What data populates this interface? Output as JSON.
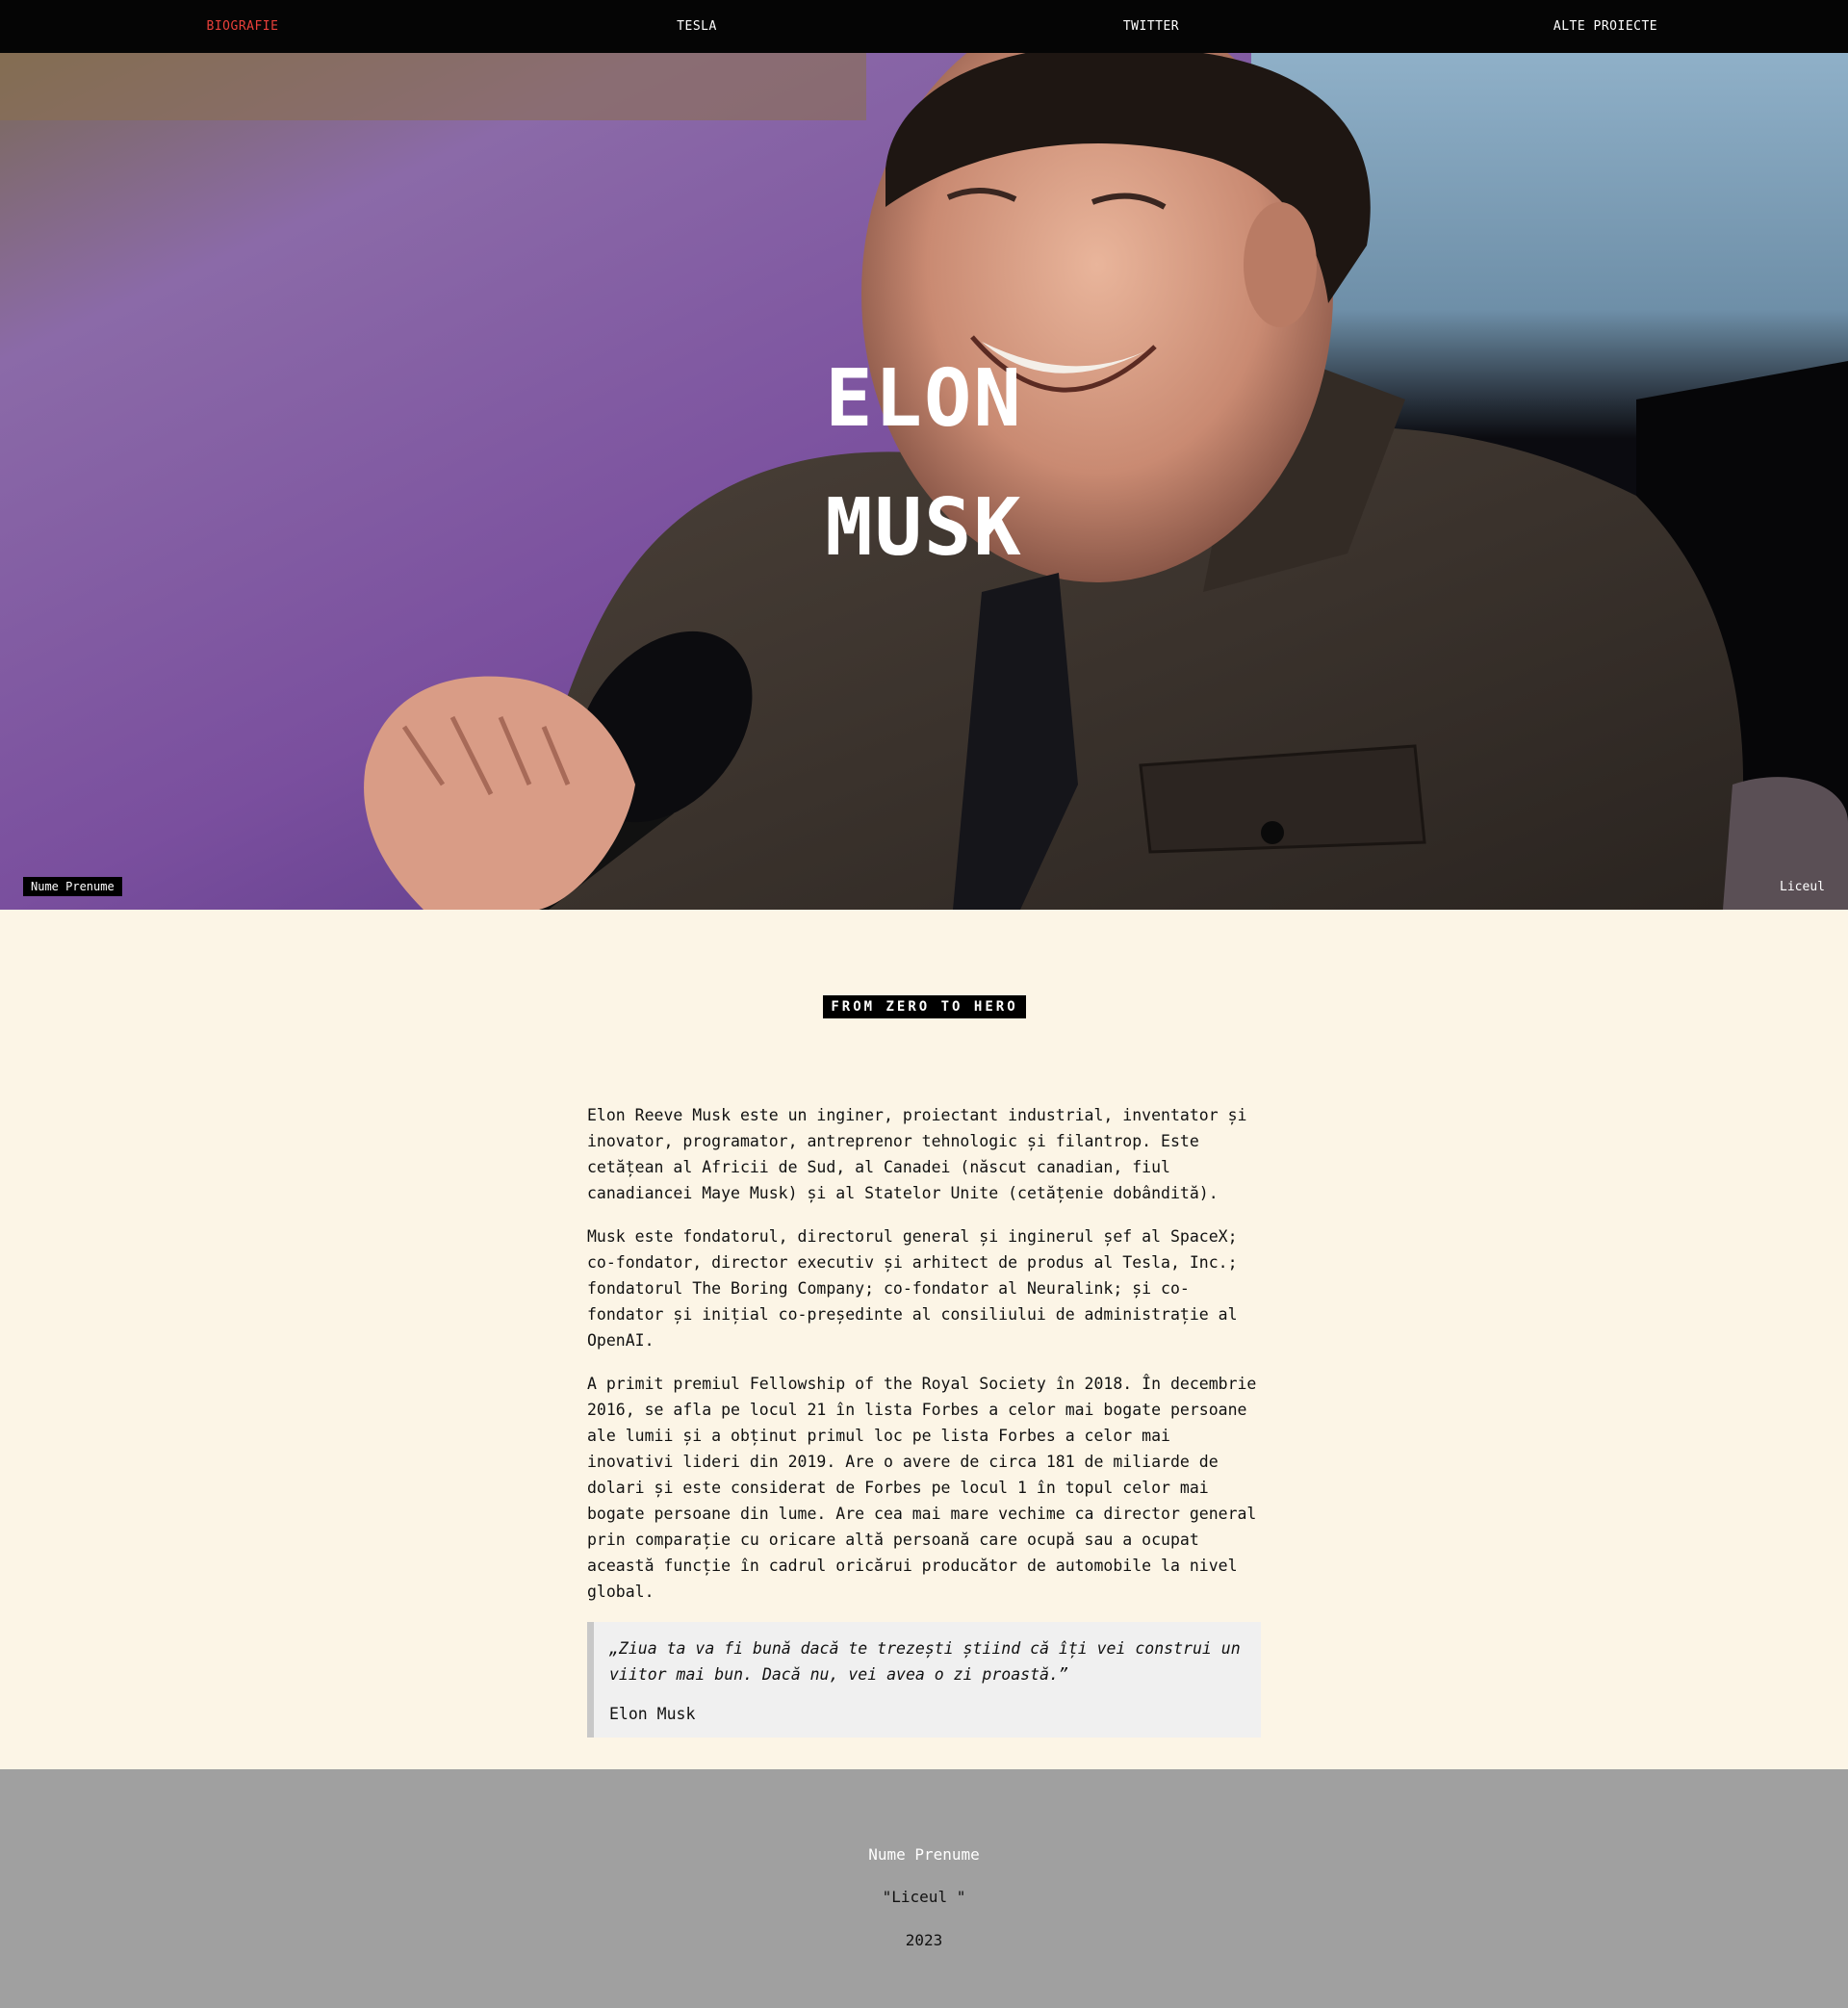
{
  "nav": {
    "items": [
      {
        "label": "BIOGRAFIE",
        "active": true
      },
      {
        "label": "TESLA",
        "active": false
      },
      {
        "label": "TWITTER",
        "active": false
      },
      {
        "label": "ALTE PROIECTE",
        "active": false
      }
    ],
    "active_color": "#e8403a"
  },
  "hero": {
    "first_name": "ELON",
    "last_name": "MUSK",
    "author_tag": "Nume Prenume",
    "school_tag": "Liceul"
  },
  "section": {
    "badge": "FROM ZERO TO HERO",
    "paragraphs": [
      "Elon Reeve Musk este un inginer, proiectant industrial, inventator și inovator, programator, antreprenor tehnologic și filantrop. Este cetățean al Africii de Sud, al Canadei (născut canadian, fiul canadiancei Maye Musk) și al Statelor Unite (cetățenie dobândită).",
      "Musk este fondatorul, directorul general și inginerul șef al SpaceX; co-fondator, director executiv și arhitect de produs al Tesla, Inc.; fondatorul The Boring Company; co-fondator al Neuralink; și co-fondator și inițial co-președinte al consiliului de administrație al OpenAI.",
      "A primit premiul Fellowship of the Royal Society în 2018. În decembrie 2016, se afla pe locul 21 în lista Forbes a celor mai bogate persoane ale lumii și a obținut primul loc pe lista Forbes a celor mai inovativi lideri din 2019. Are o avere de circa 181 de miliarde de dolari și este considerat de Forbes pe locul 1 în topul celor mai bogate persoane din lume. Are cea mai mare vechime ca director general prin comparație cu oricare altă persoană care ocupă sau a ocupat această funcție în cadrul oricărui producător de automobile la nivel global."
    ],
    "quote": {
      "text": "„Ziua ta va fi bună dacă te trezești știind că îți vei construi un viitor mai bun. Dacă nu, vei avea o zi proastă.”",
      "author": "Elon Musk"
    }
  },
  "footer": {
    "name": "Nume Prenume",
    "school": "\"Liceul \"",
    "year": "2023"
  }
}
